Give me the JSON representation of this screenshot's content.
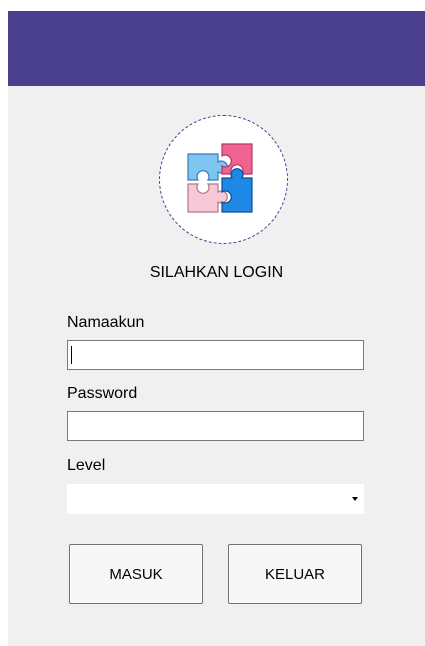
{
  "window": {
    "accent_color": "#4a3f8c",
    "background_color": "#f0f0f0"
  },
  "logo": {
    "icon": "puzzle-icon",
    "colors": [
      "#7cc6f0",
      "#f06292",
      "#f8c8d8",
      "#1e88e5"
    ]
  },
  "heading": "SILAHKAN LOGIN",
  "form": {
    "username": {
      "label": "Namaakun",
      "value": ""
    },
    "password": {
      "label": "Password",
      "value": ""
    },
    "level": {
      "label": "Level",
      "selected": ""
    }
  },
  "buttons": {
    "login_label": "MASUK",
    "exit_label": "KELUAR"
  }
}
